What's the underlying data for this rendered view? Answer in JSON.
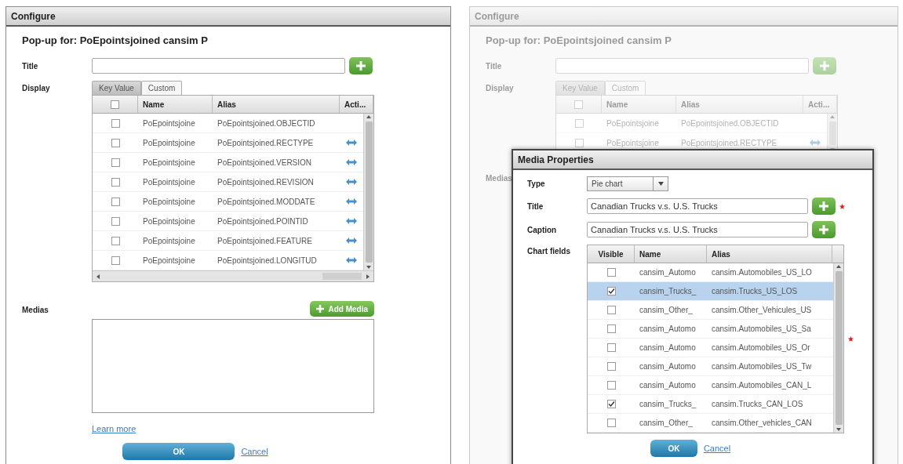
{
  "configure": {
    "title": "Configure",
    "heading": "Pop-up for: PoEpointsjoined cansim P",
    "title_label": "Title",
    "display_label": "Display",
    "tabs": [
      {
        "label": "Key Value",
        "selected": true
      },
      {
        "label": "Custom",
        "selected": false
      }
    ],
    "header_checked": false,
    "columns": [
      "Name",
      "Alias",
      "Acti..."
    ],
    "rows": [
      {
        "checked": false,
        "name": "PoEpointsjoine",
        "alias": "PoEpointsjoined.OBJECTID",
        "action": false
      },
      {
        "checked": false,
        "name": "PoEpointsjoine",
        "alias": "PoEpointsjoined.RECTYPE",
        "action": true
      },
      {
        "checked": false,
        "name": "PoEpointsjoine",
        "alias": "PoEpointsjoined.VERSION",
        "action": true
      },
      {
        "checked": false,
        "name": "PoEpointsjoine",
        "alias": "PoEpointsjoined.REVISION",
        "action": true
      },
      {
        "checked": false,
        "name": "PoEpointsjoine",
        "alias": "PoEpointsjoined.MODDATE",
        "action": true
      },
      {
        "checked": false,
        "name": "PoEpointsjoine",
        "alias": "PoEpointsjoined.POINTID",
        "action": true
      },
      {
        "checked": false,
        "name": "PoEpointsjoine",
        "alias": "PoEpointsjoined.FEATURE",
        "action": true
      },
      {
        "checked": false,
        "name": "PoEpointsjoine",
        "alias": "PoEpointsjoined.LONGITUD",
        "action": true
      }
    ],
    "medias_label": "Medias",
    "add_media_button": "Add Media",
    "learn_more_link": "Learn more",
    "ok_button": "OK",
    "cancel_link": "Cancel"
  },
  "background_dialog": {
    "title": "Configure",
    "heading": "Pop-up for: PoEpointsjoined cansim P",
    "title_label": "Title",
    "display_label": "Display",
    "tabs": [
      {
        "label": "Key Value",
        "selected": true
      },
      {
        "label": "Custom",
        "selected": false
      }
    ],
    "header_checked": false,
    "columns": [
      "Name",
      "Alias",
      "Acti..."
    ],
    "rows": [
      {
        "checked": false,
        "name": "PoEpointsjoine",
        "alias": "PoEpointsjoined.OBJECTID",
        "action": false
      },
      {
        "checked": false,
        "name": "PoEpointsjoine",
        "alias": "PoEpointsjoined.RECTYPE",
        "action": true
      }
    ],
    "medias_label": "Medias"
  },
  "media_properties": {
    "title": "Media Properties",
    "type_label": "Type",
    "type_value": "Pie chart",
    "title_label": "Title",
    "title_value": "Canadian Trucks v.s. U.S. Trucks",
    "title_required": true,
    "caption_label": "Caption",
    "caption_value": "Canadian Trucks v.s. U.S. Trucks",
    "caption_required": false,
    "chart_fields_label": "Chart fields",
    "chart_fields_required": true,
    "columns": [
      "Visible",
      "Name",
      "Alias"
    ],
    "rows": [
      {
        "checked": false,
        "selected": false,
        "name": "cansim_Automo",
        "alias": "cansim.Automobiles_US_LO"
      },
      {
        "checked": true,
        "selected": true,
        "name": "cansim_Trucks_",
        "alias": "cansim.Trucks_US_LOS"
      },
      {
        "checked": false,
        "selected": false,
        "name": "cansim_Other_",
        "alias": "cansim.Other_Vehicules_US"
      },
      {
        "checked": false,
        "selected": false,
        "name": "cansim_Automo",
        "alias": "cansim.Automobiles_US_Sa"
      },
      {
        "checked": false,
        "selected": false,
        "name": "cansim_Automo",
        "alias": "cansim.Automobiles_US_Or"
      },
      {
        "checked": false,
        "selected": false,
        "name": "cansim_Automo",
        "alias": "cansim.Automobiles_US_Tw"
      },
      {
        "checked": false,
        "selected": false,
        "name": "cansim_Automo",
        "alias": "cansim.Automobiles_CAN_L"
      },
      {
        "checked": true,
        "selected": false,
        "name": "cansim_Trucks_",
        "alias": "cansim.Trucks_CAN_LOS"
      },
      {
        "checked": false,
        "selected": false,
        "name": "cansim_Other_",
        "alias": "cansim.Other_vehicles_CAN"
      }
    ],
    "ok_button": "OK",
    "cancel_link": "Cancel"
  }
}
